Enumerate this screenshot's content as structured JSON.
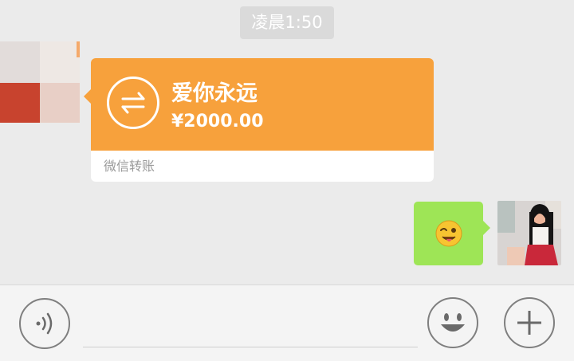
{
  "chat": {
    "timestamp": "凌晨1:50",
    "transfer": {
      "title": "爱你永远",
      "amount": "¥2000.00",
      "footer": "微信转账",
      "accent": "#f7a13c"
    },
    "sticker": {
      "icon": "winking-tongue-emoji",
      "bubble_color": "#9ee556"
    }
  },
  "input_bar": {
    "voice_icon": "voice-icon",
    "emoji_icon": "smiley-icon",
    "more_icon": "plus-icon"
  }
}
